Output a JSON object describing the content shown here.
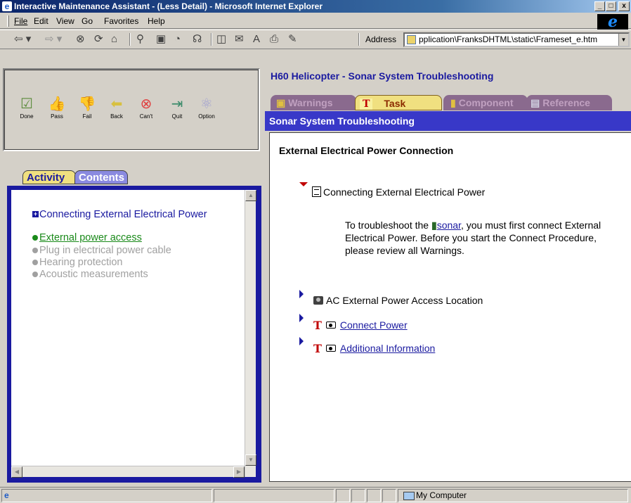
{
  "window": {
    "title": "Interactive Maintenance Assistant - (Less Detail) - Microsoft Internet Explorer",
    "controls": [
      "_",
      "□",
      "x"
    ]
  },
  "menu": {
    "items": [
      "File",
      "Edit",
      "View",
      "Go",
      "Favorites",
      "Help"
    ]
  },
  "toolbar": {
    "address_label": "Address",
    "address_value": "pplication\\FranksDHTML\\static\\Frameset_e.htm"
  },
  "nav_buttons": [
    {
      "label": "Done",
      "icon": "clipboard-check-icon"
    },
    {
      "label": "Pass",
      "icon": "thumbs-up-icon"
    },
    {
      "label": "Fail",
      "icon": "thumbs-down-icon"
    },
    {
      "label": "Back",
      "icon": "back-arrow-icon"
    },
    {
      "label": "Can't",
      "icon": "cancel-icon"
    },
    {
      "label": "Quit",
      "icon": "exit-door-icon"
    },
    {
      "label": "Option",
      "icon": "options-atom-icon"
    }
  ],
  "left_tabs": {
    "activity": "Activity",
    "contents": "Contents"
  },
  "contents_list": [
    {
      "label": "Connecting External Electrical Power",
      "state": "current"
    },
    {
      "label": "External power access",
      "state": "active"
    },
    {
      "label": "Plug in electrical power cable",
      "state": "pending"
    },
    {
      "label": "Hearing protection",
      "state": "pending"
    },
    {
      "label": "Acoustic measurements",
      "state": "pending"
    }
  ],
  "right": {
    "page_title": "H60 Helicopter - Sonar System Troubleshooting",
    "tabs": {
      "warnings": "Warnings",
      "task": "Task",
      "component": "Component",
      "reference": "Reference"
    },
    "section_title": "Sonar System Troubleshooting",
    "heading": "External Electrical Power Connection",
    "procedure_title": "Connecting External Electrical Power",
    "paragraph_pre": "To troubleshoot the ",
    "paragraph_link": "sonar",
    "paragraph_post": ", you must first connect External Electrical Power. Before you start the Connect Procedure, please review all Warnings.",
    "items": {
      "ac_location": "AC External Power Access Location",
      "connect_power": "Connect Power",
      "additional_info": "Additional Information"
    }
  },
  "statusbar": {
    "zone": "My Computer"
  },
  "colors": {
    "accent_blue": "#1a1aa0",
    "section_bar": "#3838c8",
    "task_tab": "#f0e080",
    "inactive_tab": "#8a6a8e",
    "active_green": "#1a8a1a",
    "pending_gray": "#a0a0a0"
  }
}
